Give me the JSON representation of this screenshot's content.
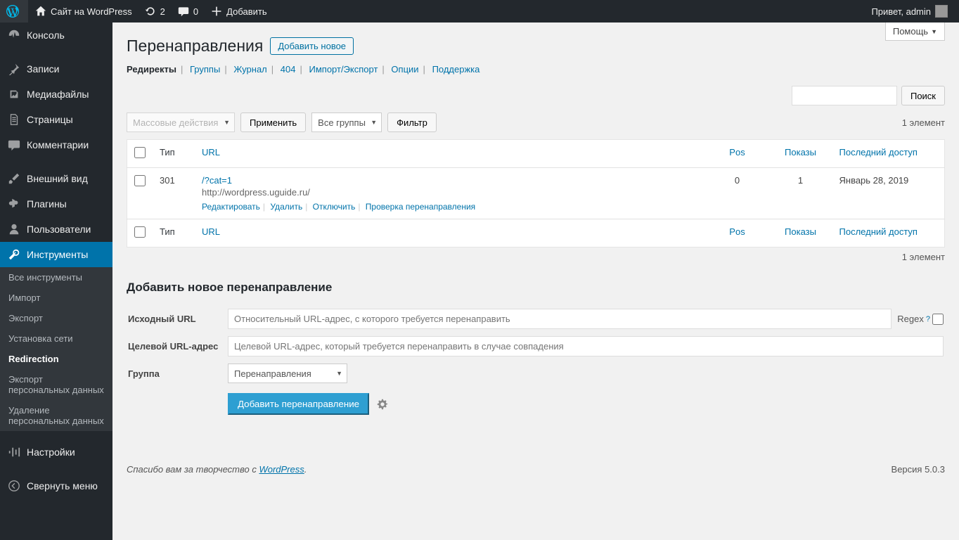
{
  "adminbar": {
    "site_title": "Сайт на WordPress",
    "refresh_count": "2",
    "comments_count": "0",
    "add_new": "Добавить",
    "greeting": "Привет, admin"
  },
  "menu": {
    "dashboard": "Консоль",
    "posts": "Записи",
    "media": "Медиафайлы",
    "pages": "Страницы",
    "comments": "Комментарии",
    "appearance": "Внешний вид",
    "plugins": "Плагины",
    "users": "Пользователи",
    "tools": "Инструменты",
    "settings": "Настройки",
    "collapse": "Свернуть меню"
  },
  "submenu": {
    "all_tools": "Все инструменты",
    "import": "Импорт",
    "export": "Экспорт",
    "network_setup": "Установка сети",
    "redirection": "Redirection",
    "export_personal": "Экспорт персональных данных",
    "erase_personal": "Удаление персональных данных"
  },
  "help": "Помощь",
  "page": {
    "title": "Перенаправления",
    "add_new": "Добавить новое"
  },
  "subnav": {
    "redirects": "Редиректы",
    "groups": "Группы",
    "log": "Журнал",
    "404": "404",
    "import_export": "Импорт/Экспорт",
    "options": "Опции",
    "support": "Поддержка"
  },
  "search": {
    "button": "Поиск"
  },
  "toolbar": {
    "bulk_actions": "Массовые действия",
    "apply": "Применить",
    "all_groups": "Все группы",
    "filter": "Фильтр",
    "count": "1 элемент"
  },
  "table": {
    "headers": {
      "type": "Тип",
      "url": "URL",
      "pos": "Pos",
      "hits": "Показы",
      "last_access": "Последний доступ"
    },
    "rows": [
      {
        "code": "301",
        "source": "/?cat=1",
        "target": "http://wordpress.uguide.ru/",
        "pos": "0",
        "hits": "1",
        "last": "Январь 28, 2019"
      }
    ],
    "actions": {
      "edit": "Редактировать",
      "delete": "Удалить",
      "disable": "Отключить",
      "check": "Проверка перенаправления"
    }
  },
  "below_count": "1 элемент",
  "add_form": {
    "title": "Добавить новое перенаправление",
    "source_label": "Исходный URL",
    "source_placeholder": "Относительный URL-адрес, с которого требуется перенаправить",
    "regex_label": "Regex",
    "target_label": "Целевой URL-адрес",
    "target_placeholder": "Целевой URL-адрес, который требуется перенаправить в случае совпадения",
    "group_label": "Группа",
    "group_value": "Перенаправления",
    "submit": "Добавить перенаправление"
  },
  "footer": {
    "thanks": "Спасибо вам за творчество с ",
    "wp": "WordPress",
    "period": ".",
    "version": "Версия 5.0.3"
  }
}
